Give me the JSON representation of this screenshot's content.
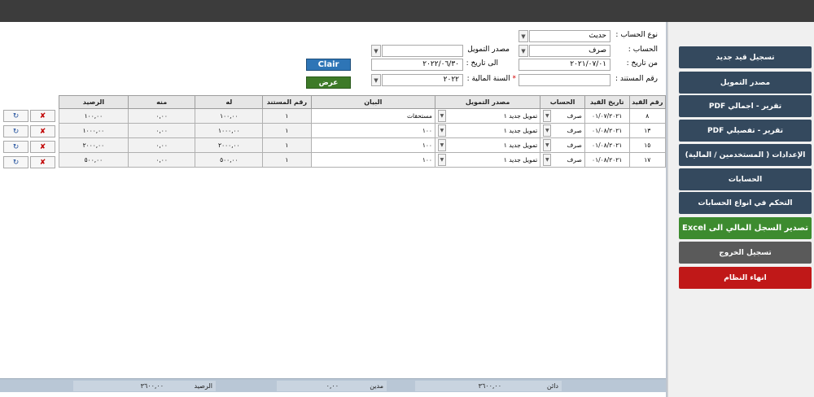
{
  "sidebar": {
    "buttons": [
      {
        "label": "تسجيل قيد جديد"
      },
      {
        "label": "مصدر التمويل"
      },
      {
        "label": "تقرير - اجمالي PDF"
      },
      {
        "label": "تقرير - تفصيلي PDF"
      },
      {
        "label": "الإعدادات ( المستخدمين / المالية)"
      },
      {
        "label": "الحسابات"
      },
      {
        "label": "التحكم في انواع الحسابات"
      },
      {
        "label": "تصدير السجل المالي الى Excel"
      },
      {
        "label": "تسجيل الخروج"
      },
      {
        "label": "انهاء النظام"
      }
    ]
  },
  "filters": {
    "account_type_label": "نوع الحساب :",
    "account_type_value": "حديث",
    "account_label": "الحساب :",
    "account_value": "صرف",
    "funding_label": "مصدر التمويل",
    "funding_value": "",
    "from_date_label": "من تاريخ :",
    "from_date_value": "٢٠٢١/٠٧/٠١",
    "to_date_label": "الى تاريخ :",
    "to_date_value": "٢٠٢٢/٠٦/٣٠",
    "doc_no_label": "رقم المستند :",
    "doc_no_value": "",
    "fiscal_year_label": "السنة المالية :",
    "fiscal_year_required": "*",
    "fiscal_year_value": "٢٠٢٢",
    "clear_label": "Clair",
    "show_label": "عرض"
  },
  "table": {
    "headers": [
      "رقم القيد",
      "تاريخ القيد",
      "الحساب",
      "مصدر التمويل",
      "البيان",
      "رقم المستند",
      "له",
      "منه",
      "الرصيد"
    ],
    "rows": [
      {
        "entry_no": "٨",
        "date": "٠١/٠٧/٢٠٢١",
        "account": "صرف",
        "funding": "تمويل جديد ١",
        "statement": "مستحقات",
        "doc_no": "١",
        "credit": "١٠٠,٠٠",
        "debit": "٠,٠٠",
        "balance": "١٠٠,٠٠"
      },
      {
        "entry_no": "١٣",
        "date": "٠١/٠٨/٢٠٢١",
        "account": "صرف",
        "funding": "تمويل جديد ١",
        "statement": "١٠٠",
        "doc_no": "١",
        "credit": "١٠٠٠,٠٠",
        "debit": "٠,٠٠",
        "balance": "١٠٠٠,٠٠"
      },
      {
        "entry_no": "١٥",
        "date": "٠١/٠٨/٢٠٢١",
        "account": "صرف",
        "funding": "تمويل جديد ١",
        "statement": "١٠٠",
        "doc_no": "١",
        "credit": "٢٠٠٠,٠٠",
        "debit": "٠,٠٠",
        "balance": "٢٠٠٠,٠٠"
      },
      {
        "entry_no": "١٧",
        "date": "٠١/٠٨/٢٠٢١",
        "account": "صرف",
        "funding": "تمويل جديد ١",
        "statement": "١٠٠",
        "doc_no": "١",
        "credit": "٥٠٠,٠٠",
        "debit": "٠,٠٠",
        "balance": "٥٠٠,٠٠"
      }
    ],
    "delete_icon": "✘",
    "refresh_icon": "↻"
  },
  "footer": {
    "credit_label": "دائن",
    "credit_value": "٣٦٠٠,٠٠",
    "debit_label": "مدين",
    "debit_value": "٠,٠٠",
    "balance_label": "الرصيد",
    "balance_value": "٣٦٠٠,٠٠"
  }
}
